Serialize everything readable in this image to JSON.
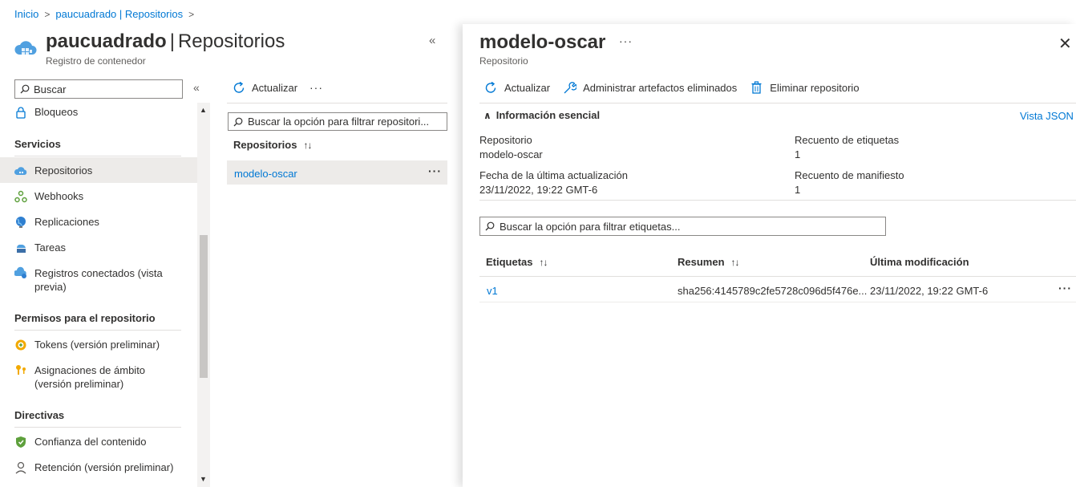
{
  "breadcrumb": {
    "home": "Inicio",
    "current": "paucuadrado | Repositorios"
  },
  "resource": {
    "name": "paucuadrado",
    "section": "Repositorios",
    "type": "Registro de contenedor"
  },
  "sidebar": {
    "search_placeholder": "Buscar",
    "items_top": [
      {
        "label": "Bloqueos",
        "icon": "lock-icon"
      }
    ],
    "sections": [
      {
        "title": "Servicios",
        "items": [
          {
            "label": "Repositorios",
            "icon": "cloud-icon",
            "active": true
          },
          {
            "label": "Webhooks",
            "icon": "webhook-icon"
          },
          {
            "label": "Replicaciones",
            "icon": "globe-icon"
          },
          {
            "label": "Tareas",
            "icon": "tasks-icon"
          },
          {
            "label": "Registros conectados (vista previa)",
            "icon": "connected-registry-icon"
          }
        ]
      },
      {
        "title": "Permisos para el repositorio",
        "items": [
          {
            "label": "Tokens (versión preliminar)",
            "icon": "token-icon"
          },
          {
            "label": "Asignaciones de ámbito (versión preliminar)",
            "icon": "scope-map-icon"
          }
        ]
      },
      {
        "title": "Directivas",
        "items": [
          {
            "label": "Confianza del contenido",
            "icon": "shield-icon"
          },
          {
            "label": "Retención (versión preliminar)",
            "icon": "retention-icon"
          }
        ]
      }
    ]
  },
  "middle": {
    "refresh_label": "Actualizar",
    "search_placeholder": "Buscar la opción para filtrar repositori...",
    "column_header": "Repositorios",
    "rows": [
      {
        "name": "modelo-oscar"
      }
    ]
  },
  "blade": {
    "title": "modelo-oscar",
    "subtitle": "Repositorio",
    "toolbar": {
      "refresh": "Actualizar",
      "manage_deleted": "Administrar artefactos eliminados",
      "delete_repo": "Eliminar repositorio"
    },
    "essentials": {
      "label": "Información esencial",
      "json_link": "Vista JSON",
      "props": [
        {
          "label": "Repositorio",
          "value": "modelo-oscar"
        },
        {
          "label": "Recuento de etiquetas",
          "value": "1"
        },
        {
          "label": "Fecha de la última actualización",
          "value": "23/11/2022, 19:22 GMT-6"
        },
        {
          "label": "Recuento de manifiesto",
          "value": "1"
        }
      ]
    },
    "tag_search_placeholder": "Buscar la opción para filtrar etiquetas...",
    "table": {
      "headers": {
        "tags": "Etiquetas",
        "digest": "Resumen",
        "modified": "Última modificación"
      },
      "rows": [
        {
          "tag": "v1",
          "digest": "sha256:4145789c2fe5728c096d5f476e...",
          "modified": "23/11/2022, 19:22 GMT-6"
        }
      ]
    }
  },
  "colors": {
    "accent": "#0078d4",
    "selected_row": "#edebe9",
    "border": "#8a8886"
  }
}
